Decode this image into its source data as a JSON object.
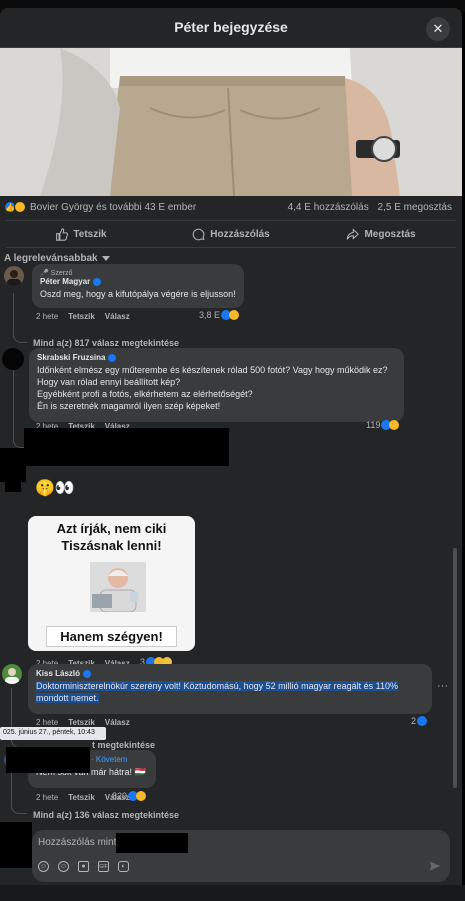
{
  "header": {
    "title": "Péter bejegyzése",
    "close_label": "✕"
  },
  "reactions": {
    "names": "Bovier György és további 43 E ember",
    "comments": "4,4 E hozzászólás",
    "shares": "2,5 E megosztás"
  },
  "actions": {
    "like": "Tetszik",
    "comment": "Hozzászólás",
    "share": "Megosztás"
  },
  "sort": {
    "label": "A legrelevánsabbak"
  },
  "comments": [
    {
      "author_badge": "🎤 Szerző",
      "author": "Péter Magyar",
      "text": "Oszd meg, hogy a kifutópálya végére is eljusson!",
      "time": "2 hete",
      "like": "Tetszik",
      "reply": "Válasz",
      "reaction_count": "3,8 E",
      "replies_link": "Mind a(z) 817 válasz megtekintése"
    },
    {
      "author": "Skrabski Fruzsina",
      "lines": [
        "Időnként elmész egy műterembe és készítenek rólad 500 fotót? Vagy hogy működik ez?",
        "Hogy van rólad ennyi beállított kép?",
        "Egyébként profi a fotós, elkérhetem az elérhetőségét?",
        "Én is szeretnék magamról ilyen szép képeket!"
      ],
      "time": "2 hete",
      "like": "Tetszik",
      "reply": "Válasz",
      "reaction_count": "119"
    },
    {
      "emoji_text": "🤫👀",
      "meme_top": "Azt írják, nem ciki Tiszásnak lenni!",
      "meme_bottom": "Hanem szégyen!",
      "time": "2 hete",
      "like": "Tetszik",
      "reply": "Válasz",
      "reaction_count": "3"
    },
    {
      "author": "Kiss László",
      "lines": [
        "Doktorminiszterelnökúr szerény volt! Köztudomású, hogy 52 millió magyar reagált és 110%",
        "mondott nemet."
      ],
      "time": "2 hete",
      "like": "Tetszik",
      "reply": "Válasz",
      "reaction_count": "2",
      "replies_link": "t megtekintése"
    },
    {
      "follow": "· Követem",
      "text": "Nem sok van már hátra! 🇭🇺",
      "time": "2 hete",
      "like": "Tetszik",
      "reply": "Válasz",
      "reaction_count": "829",
      "replies_link": "Mind a(z) 136 válasz megtekintése"
    }
  ],
  "tooltip": "025. június 27., péntek, 10:43",
  "composer": {
    "placeholder": "Hozzászólás mint",
    "tools": [
      "avatar-icon",
      "emoji-icon",
      "camera-icon",
      "gif-icon",
      "sticker-icon"
    ]
  },
  "colors": {
    "background": "#242526",
    "bubble": "#3a3b3c",
    "accent": "#1877f2",
    "text": "#e4e6eb",
    "muted": "#b0b3b8",
    "highlight": "#1d4e8f"
  }
}
